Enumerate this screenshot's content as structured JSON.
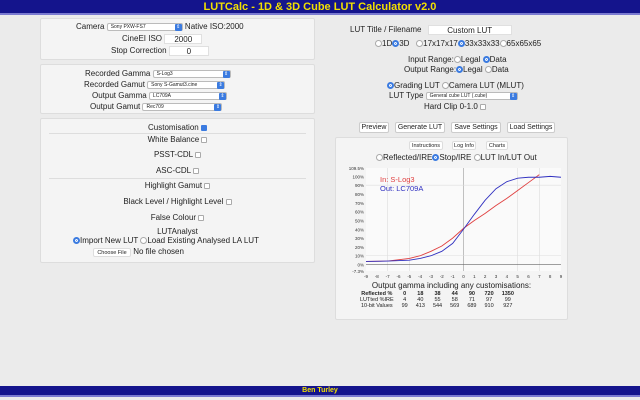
{
  "title": "LUTCalc - 1D & 3D Cube LUT Calculator v2.0",
  "footer": "Ben Turley",
  "camera": {
    "label": "Camera",
    "value": "Sony PXW-FS7",
    "native_iso": "Native ISO:2000",
    "cineei_label": "CineEI ISO",
    "cineei_value": "2000",
    "stop_label": "Stop Correction",
    "stop_value": "0"
  },
  "gamma": {
    "rec_gamma_label": "Recorded Gamma",
    "rec_gamma": "S-Log3",
    "rec_gamut_label": "Recorded Gamut",
    "rec_gamut": "Sony S-Gamut3.cine",
    "out_gamma_label": "Output Gamma",
    "out_gamma": "LC709A",
    "out_gamut_label": "Output Gamut",
    "out_gamut": "Rec709"
  },
  "custom": {
    "title": "Customisation",
    "white_balance": "White Balance",
    "psst": "PSST-CDL",
    "asc": "ASC-CDL",
    "highlight_gamut": "Highlight Gamut",
    "black_level": "Black Level / Highlight Level",
    "false_colour": "False Colour",
    "lutanalyst": "LUTAnalyst",
    "import_new": "Import New LUT",
    "load_existing": "Load Existing Analysed LA LUT",
    "choose_file": "Choose File",
    "no_file": "No file chosen"
  },
  "lut": {
    "title_label": "LUT Title / Filename",
    "title_value": "Custom LUT",
    "d1": "1D",
    "d3": "3D",
    "s17": "17x17x17",
    "s33": "33x33x33",
    "s65": "65x65x65",
    "input_range": "Input Range:",
    "output_range": "Output Range:",
    "legal": "Legal",
    "data": "Data",
    "grading": "Grading LUT",
    "camera_lut": "Camera LUT (MLUT)",
    "type_label": "LUT Type",
    "type_value": "General cube LUT (.cube)",
    "hard_clip": "Hard Clip 0-1.0"
  },
  "buttons": {
    "preview": "Preview",
    "generate": "Generate LUT",
    "save": "Save Settings",
    "load": "Load Settings",
    "instructions": "Instructions",
    "log_info": "Log Info",
    "charts": "Charts"
  },
  "chart_opts": {
    "reflected": "Reflected/IRE",
    "stop": "Stop/IRE",
    "lutinout": "LUT In/LUT Out"
  },
  "chart_data": {
    "type": "line",
    "legend_in": "In: S-Log3",
    "legend_out": "Out: LC709A",
    "xlim": [
      -9,
      9
    ],
    "ylim": [
      -7.3,
      109.5
    ],
    "x_ticks": [
      "-9",
      "-8",
      "-7",
      "-6",
      "-5",
      "-4",
      "-3",
      "-2",
      "-1",
      "0",
      "1",
      "2",
      "3",
      "4",
      "5",
      "6",
      "7",
      "8",
      "9"
    ],
    "y_ticks": [
      {
        "v": 109.5,
        "t": "109.5%"
      },
      {
        "v": 100,
        "t": "100%"
      },
      {
        "v": 90,
        "t": "90%"
      },
      {
        "v": 80,
        "t": "80%"
      },
      {
        "v": 70,
        "t": "70%"
      },
      {
        "v": 60,
        "t": "60%"
      },
      {
        "v": 50,
        "t": "50%"
      },
      {
        "v": 40,
        "t": "40%"
      },
      {
        "v": 30,
        "t": "30%"
      },
      {
        "v": 20,
        "t": "20%"
      },
      {
        "v": 10,
        "t": "10%"
      },
      {
        "v": 0,
        "t": "0%"
      },
      {
        "v": -7.3,
        "t": "-7.3%"
      }
    ],
    "series": [
      {
        "name": "In: S-Log3",
        "color": "#e04040",
        "x": [
          -9,
          -7,
          -5,
          -4,
          -3,
          -2,
          -1,
          0,
          1,
          2,
          3,
          4,
          5,
          6,
          7
        ],
        "y": [
          3.5,
          4,
          7,
          10,
          15,
          21,
          30,
          41,
          50,
          58,
          67,
          75,
          84,
          93,
          102
        ]
      },
      {
        "name": "Out: LC709A",
        "color": "#3030c0",
        "x": [
          -9,
          -7,
          -5,
          -4,
          -3,
          -2,
          -1,
          0,
          1,
          2,
          3,
          4,
          5,
          6,
          7,
          8,
          9
        ],
        "y": [
          3.5,
          4,
          5,
          7,
          10,
          15,
          24,
          40,
          57,
          73,
          86,
          94,
          98,
          99,
          99,
          100,
          99
        ]
      }
    ]
  },
  "table": {
    "caption": "Output gamma including any customisations:",
    "rows": [
      [
        "Reflected %",
        "0",
        "18",
        "38",
        "44",
        "90",
        "720",
        "1350"
      ],
      [
        "LUTted %IRE",
        "4",
        "40",
        "55",
        "58",
        "71",
        "97",
        "99"
      ],
      [
        "10-bit Values",
        "99",
        "413",
        "544",
        "569",
        "689",
        "910",
        "927"
      ]
    ]
  }
}
